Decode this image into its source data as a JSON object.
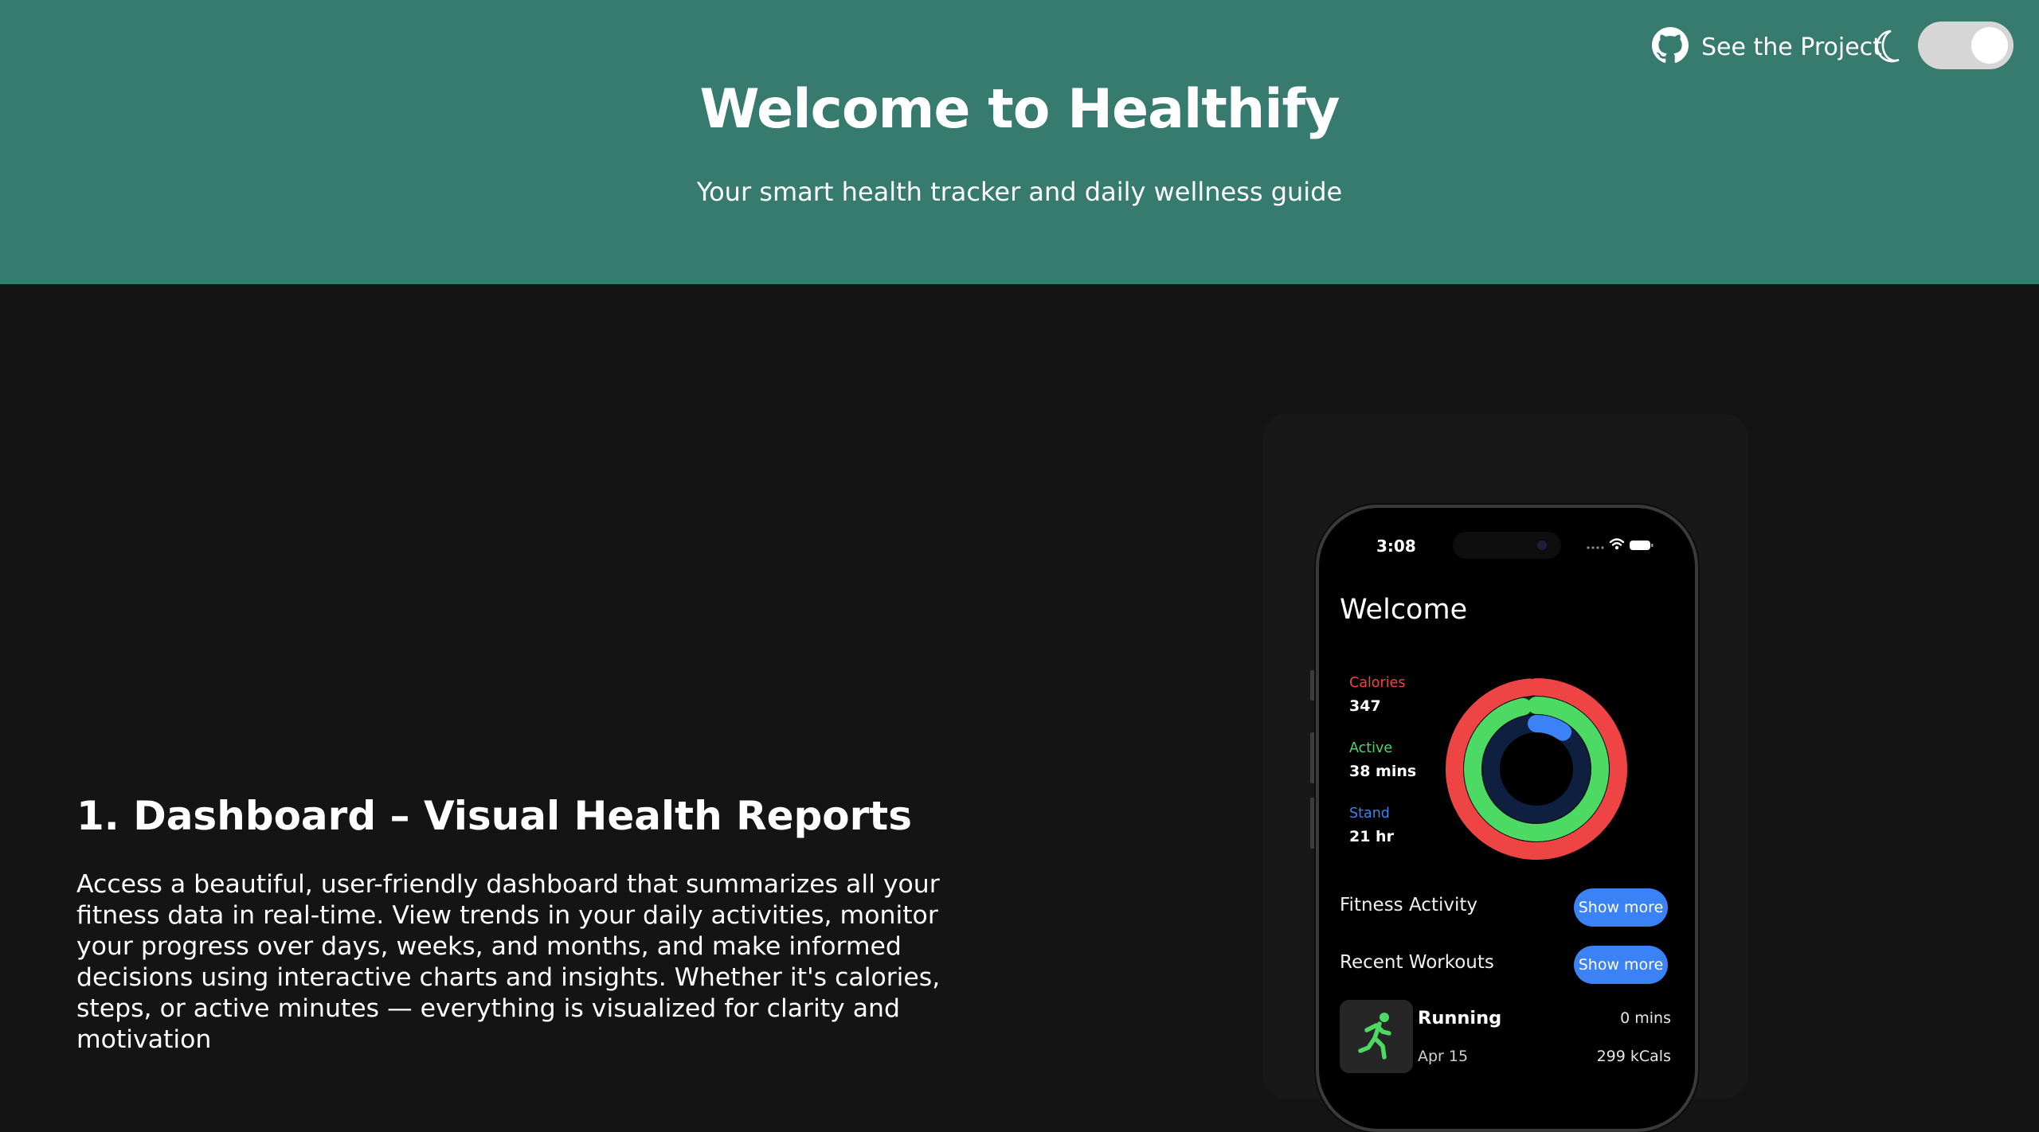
{
  "hero": {
    "title": "Welcome to Healthify",
    "subtitle": "Your smart health tracker and daily wellness guide",
    "project_link_label": "See the Project",
    "theme_toggle_on": true
  },
  "section": {
    "heading": "1. Dashboard – Visual Health Reports",
    "description": "Access a beautiful, user-friendly dashboard that summarizes all your fitness data in real-time. View trends in your daily activities, monitor your progress over days, weeks, and months, and make informed decisions using interactive charts and insights. Whether it's calories, steps, or active minutes — everything is visualized for clarity and motivation"
  },
  "phone": {
    "time": "3:08",
    "welcome": "Welcome",
    "stats": [
      {
        "label": "Calories",
        "value": "347",
        "color": "#ef4444",
        "ring_progress": 1.0
      },
      {
        "label": "Active",
        "value": "38 mins",
        "color": "#4cd964",
        "ring_progress": 0.98
      },
      {
        "label": "Stand",
        "value": "21 hr",
        "color": "#3b82f6",
        "ring_progress": 0.1
      }
    ],
    "fitness_activity_label": "Fitness Activity",
    "recent_workouts_label": "Recent Workouts",
    "show_more_label": "Show more",
    "workout": {
      "name": "Running",
      "date": "Apr 15",
      "duration": "0 mins",
      "calories": "299 kCals"
    }
  },
  "colors": {
    "hero_bg": "#367b6e",
    "page_bg": "#141414",
    "accent_blue": "#3b82f6",
    "calories_red": "#ef4444",
    "active_green": "#4cd964"
  }
}
